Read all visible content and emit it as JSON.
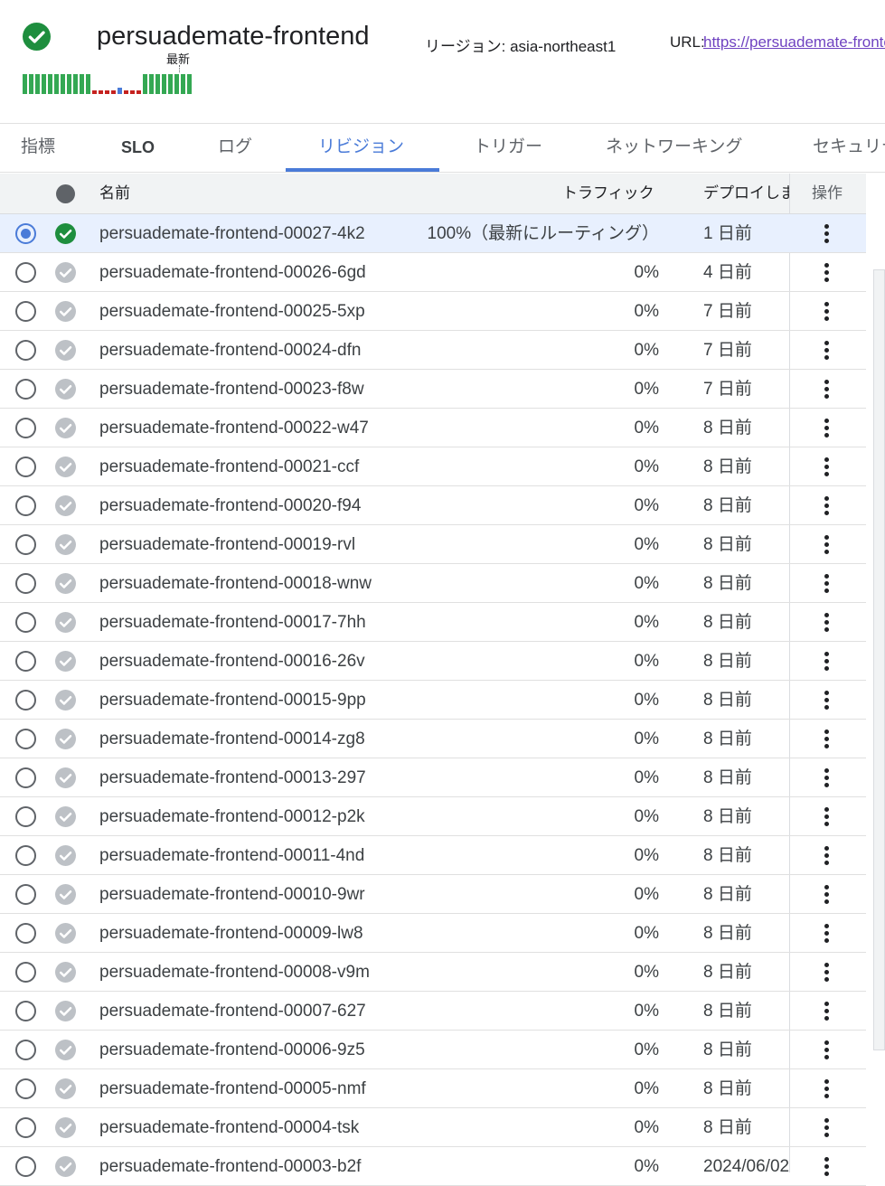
{
  "header": {
    "service_name": "persuademate-frontend",
    "latest_label": "最新",
    "region": "リージョン: asia-northeast1",
    "url_label": "URL:",
    "url_value": "https://persuademate-frontend",
    "status_icon": "check-circle-icon",
    "revision_history_bars": [
      "ok",
      "ok",
      "ok",
      "ok",
      "ok",
      "ok",
      "ok",
      "ok",
      "ok",
      "ok",
      "ok",
      "err",
      "err",
      "err",
      "err",
      "mid",
      "err",
      "err",
      "err",
      "ok",
      "ok",
      "ok",
      "ok",
      "ok",
      "ok",
      "ok",
      "ok"
    ]
  },
  "tabs": [
    {
      "label": "指標"
    },
    {
      "label": "SLO"
    },
    {
      "label": "ログ"
    },
    {
      "label": "リビジョン",
      "active": true
    },
    {
      "label": "トリガー"
    },
    {
      "label": "ネットワーキング"
    },
    {
      "label": "セキュリティ"
    }
  ],
  "table": {
    "columns": {
      "name": "名前",
      "traffic": "トラフィック",
      "deployed": "デプロイしました",
      "actions": "操作"
    },
    "rows": [
      {
        "name": "persuademate-frontend-00027-4k2",
        "traffic": "100%（最新にルーティング）",
        "deployed": "1 日前",
        "selected": true,
        "active": true
      },
      {
        "name": "persuademate-frontend-00026-6gd",
        "traffic": "0%",
        "deployed": "4 日前"
      },
      {
        "name": "persuademate-frontend-00025-5xp",
        "traffic": "0%",
        "deployed": "7 日前"
      },
      {
        "name": "persuademate-frontend-00024-dfn",
        "traffic": "0%",
        "deployed": "7 日前"
      },
      {
        "name": "persuademate-frontend-00023-f8w",
        "traffic": "0%",
        "deployed": "7 日前"
      },
      {
        "name": "persuademate-frontend-00022-w47",
        "traffic": "0%",
        "deployed": "8 日前"
      },
      {
        "name": "persuademate-frontend-00021-ccf",
        "traffic": "0%",
        "deployed": "8 日前"
      },
      {
        "name": "persuademate-frontend-00020-f94",
        "traffic": "0%",
        "deployed": "8 日前"
      },
      {
        "name": "persuademate-frontend-00019-rvl",
        "traffic": "0%",
        "deployed": "8 日前"
      },
      {
        "name": "persuademate-frontend-00018-wnw",
        "traffic": "0%",
        "deployed": "8 日前"
      },
      {
        "name": "persuademate-frontend-00017-7hh",
        "traffic": "0%",
        "deployed": "8 日前"
      },
      {
        "name": "persuademate-frontend-00016-26v",
        "traffic": "0%",
        "deployed": "8 日前"
      },
      {
        "name": "persuademate-frontend-00015-9pp",
        "traffic": "0%",
        "deployed": "8 日前"
      },
      {
        "name": "persuademate-frontend-00014-zg8",
        "traffic": "0%",
        "deployed": "8 日前"
      },
      {
        "name": "persuademate-frontend-00013-297",
        "traffic": "0%",
        "deployed": "8 日前"
      },
      {
        "name": "persuademate-frontend-00012-p2k",
        "traffic": "0%",
        "deployed": "8 日前"
      },
      {
        "name": "persuademate-frontend-00011-4nd",
        "traffic": "0%",
        "deployed": "8 日前"
      },
      {
        "name": "persuademate-frontend-00010-9wr",
        "traffic": "0%",
        "deployed": "8 日前"
      },
      {
        "name": "persuademate-frontend-00009-lw8",
        "traffic": "0%",
        "deployed": "8 日前"
      },
      {
        "name": "persuademate-frontend-00008-v9m",
        "traffic": "0%",
        "deployed": "8 日前"
      },
      {
        "name": "persuademate-frontend-00007-627",
        "traffic": "0%",
        "deployed": "8 日前"
      },
      {
        "name": "persuademate-frontend-00006-9z5",
        "traffic": "0%",
        "deployed": "8 日前"
      },
      {
        "name": "persuademate-frontend-00005-nmf",
        "traffic": "0%",
        "deployed": "8 日前"
      },
      {
        "name": "persuademate-frontend-00004-tsk",
        "traffic": "0%",
        "deployed": "8 日前"
      },
      {
        "name": "persuademate-frontend-00003-b2f",
        "traffic": "0%",
        "deployed": "2024/06/02"
      }
    ]
  },
  "colors": {
    "accent": "#4a7bd8",
    "ok_green": "#34a853",
    "ok_dark": "#1e8e3e",
    "error_red": "#c5221f",
    "inactive_check": "#bdc1c6"
  }
}
